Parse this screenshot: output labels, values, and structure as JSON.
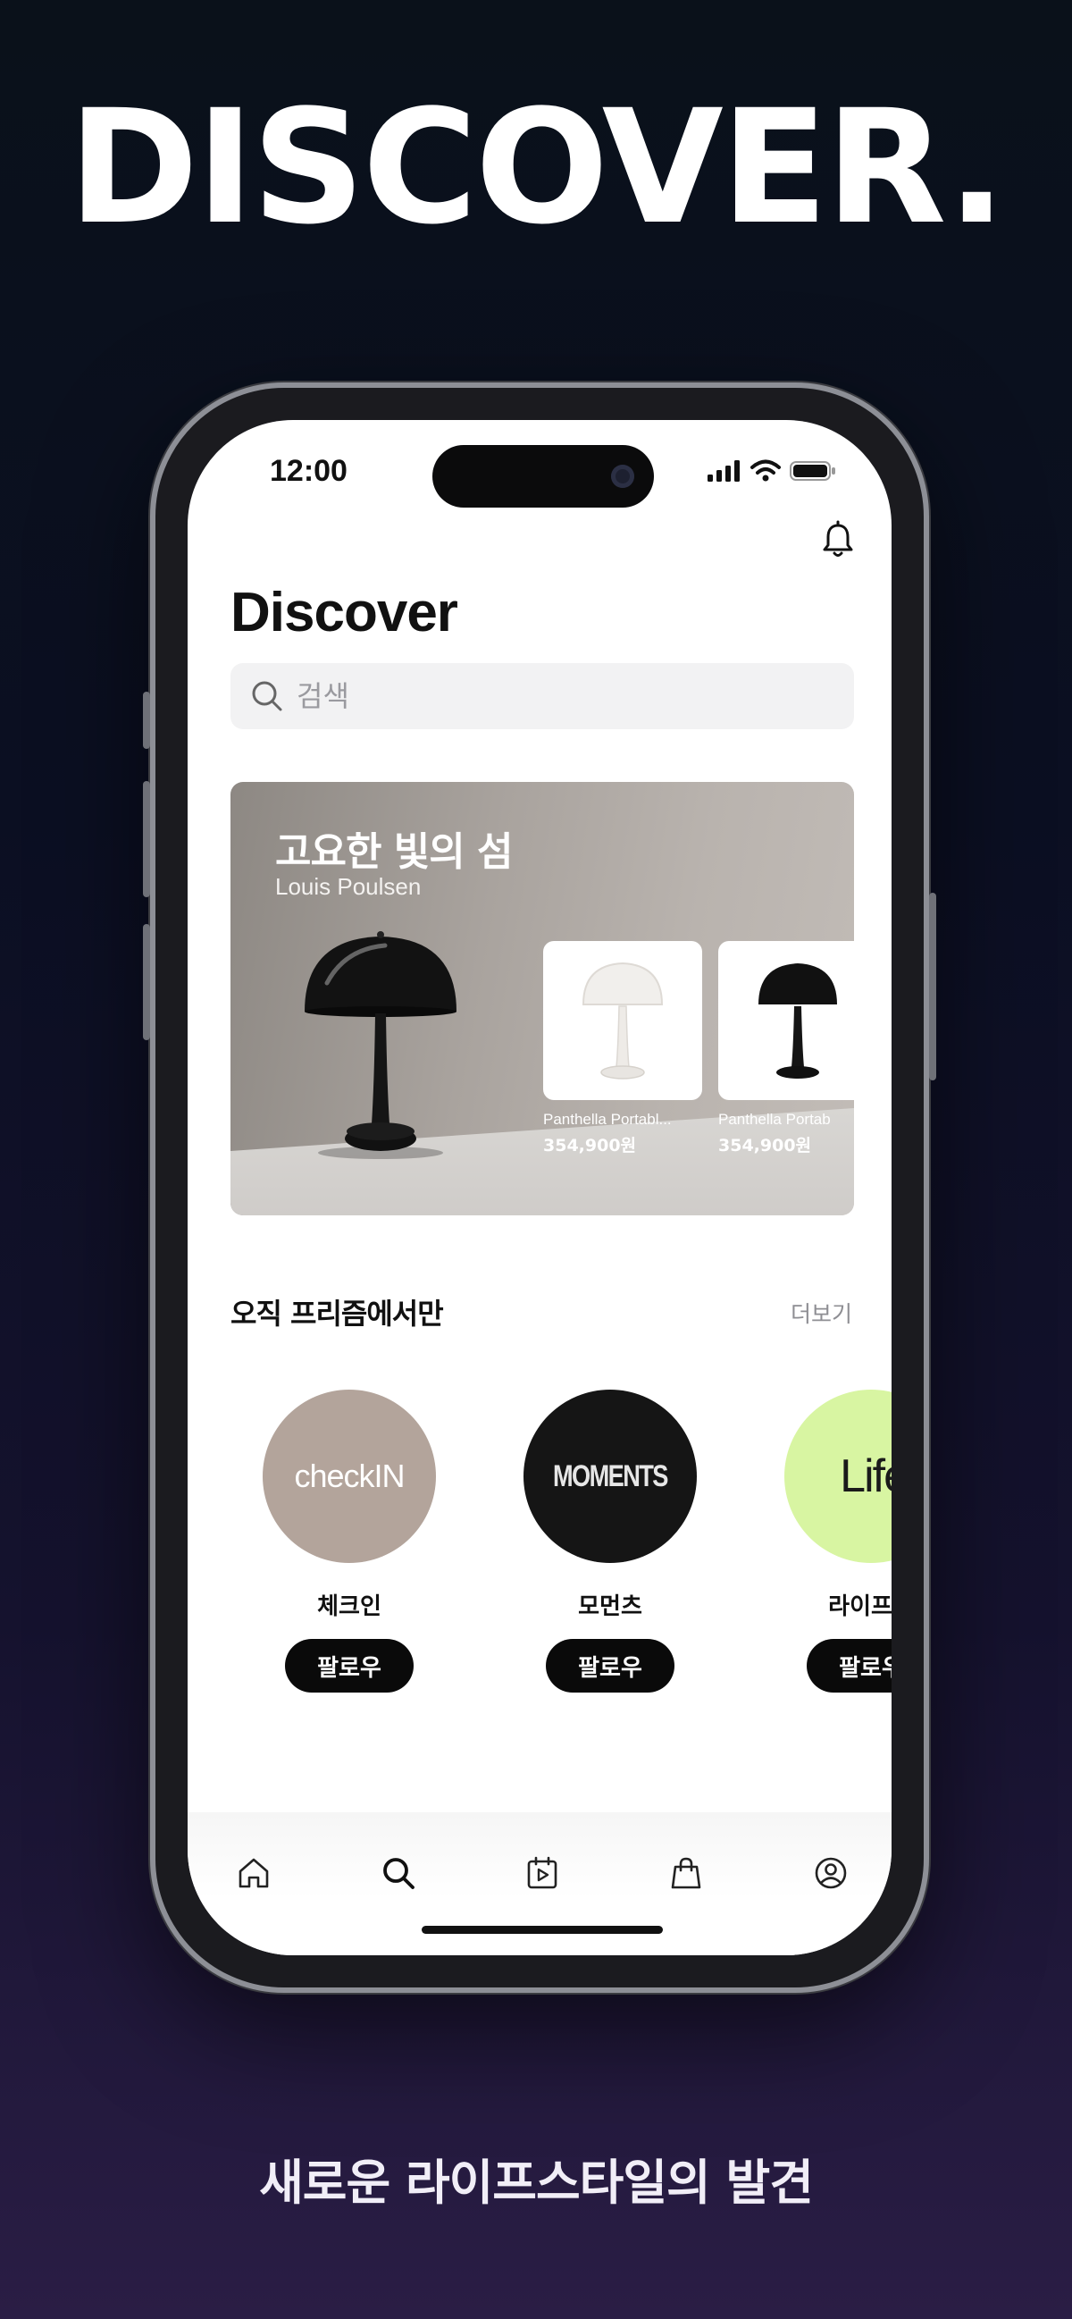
{
  "marketing": {
    "headline": "DISCOVER.",
    "tagline": "새로운 라이프스타일의 발견"
  },
  "status_bar": {
    "time": "12:00",
    "icons": [
      "cellular-signal-icon",
      "wifi-icon",
      "battery-icon"
    ]
  },
  "header": {
    "title": "Discover",
    "notification_icon": "bell-icon"
  },
  "search": {
    "placeholder": "검색",
    "icon": "search-icon"
  },
  "banner": {
    "title": "고요한 빛의 섬",
    "subtitle": "Louis Poulsen",
    "products": [
      {
        "name": "Panthella Portabl...",
        "price": "354,900원",
        "color": "white"
      },
      {
        "name": "Panthella Portab",
        "price": "354,900원",
        "color": "black"
      }
    ]
  },
  "section": {
    "title": "오직 프리즘에서만",
    "more_label": "더보기",
    "brands": [
      {
        "name": "체크인",
        "logo_text": "checkIN",
        "logo_bg": "#b3a49b",
        "follow_label": "팔로우"
      },
      {
        "name": "모먼츠",
        "logo_text": "MOMENTS",
        "logo_bg": "#151515",
        "follow_label": "팔로우"
      },
      {
        "name": "라이프로",
        "logo_text": "LifeLo",
        "logo_bg": "#d8f5a2",
        "follow_label": "팔로우"
      }
    ]
  },
  "tab_bar": {
    "tabs": [
      {
        "icon": "home-icon",
        "active": false
      },
      {
        "icon": "search-icon",
        "active": true
      },
      {
        "icon": "video-calendar-icon",
        "active": false
      },
      {
        "icon": "shopping-bag-icon",
        "active": false
      },
      {
        "icon": "profile-icon",
        "active": false
      }
    ]
  },
  "colors": {
    "background_top": "#0a111a",
    "background_bottom": "#2a1d45",
    "follow_button": "#0a0a0a",
    "search_bg": "#f2f2f3"
  }
}
